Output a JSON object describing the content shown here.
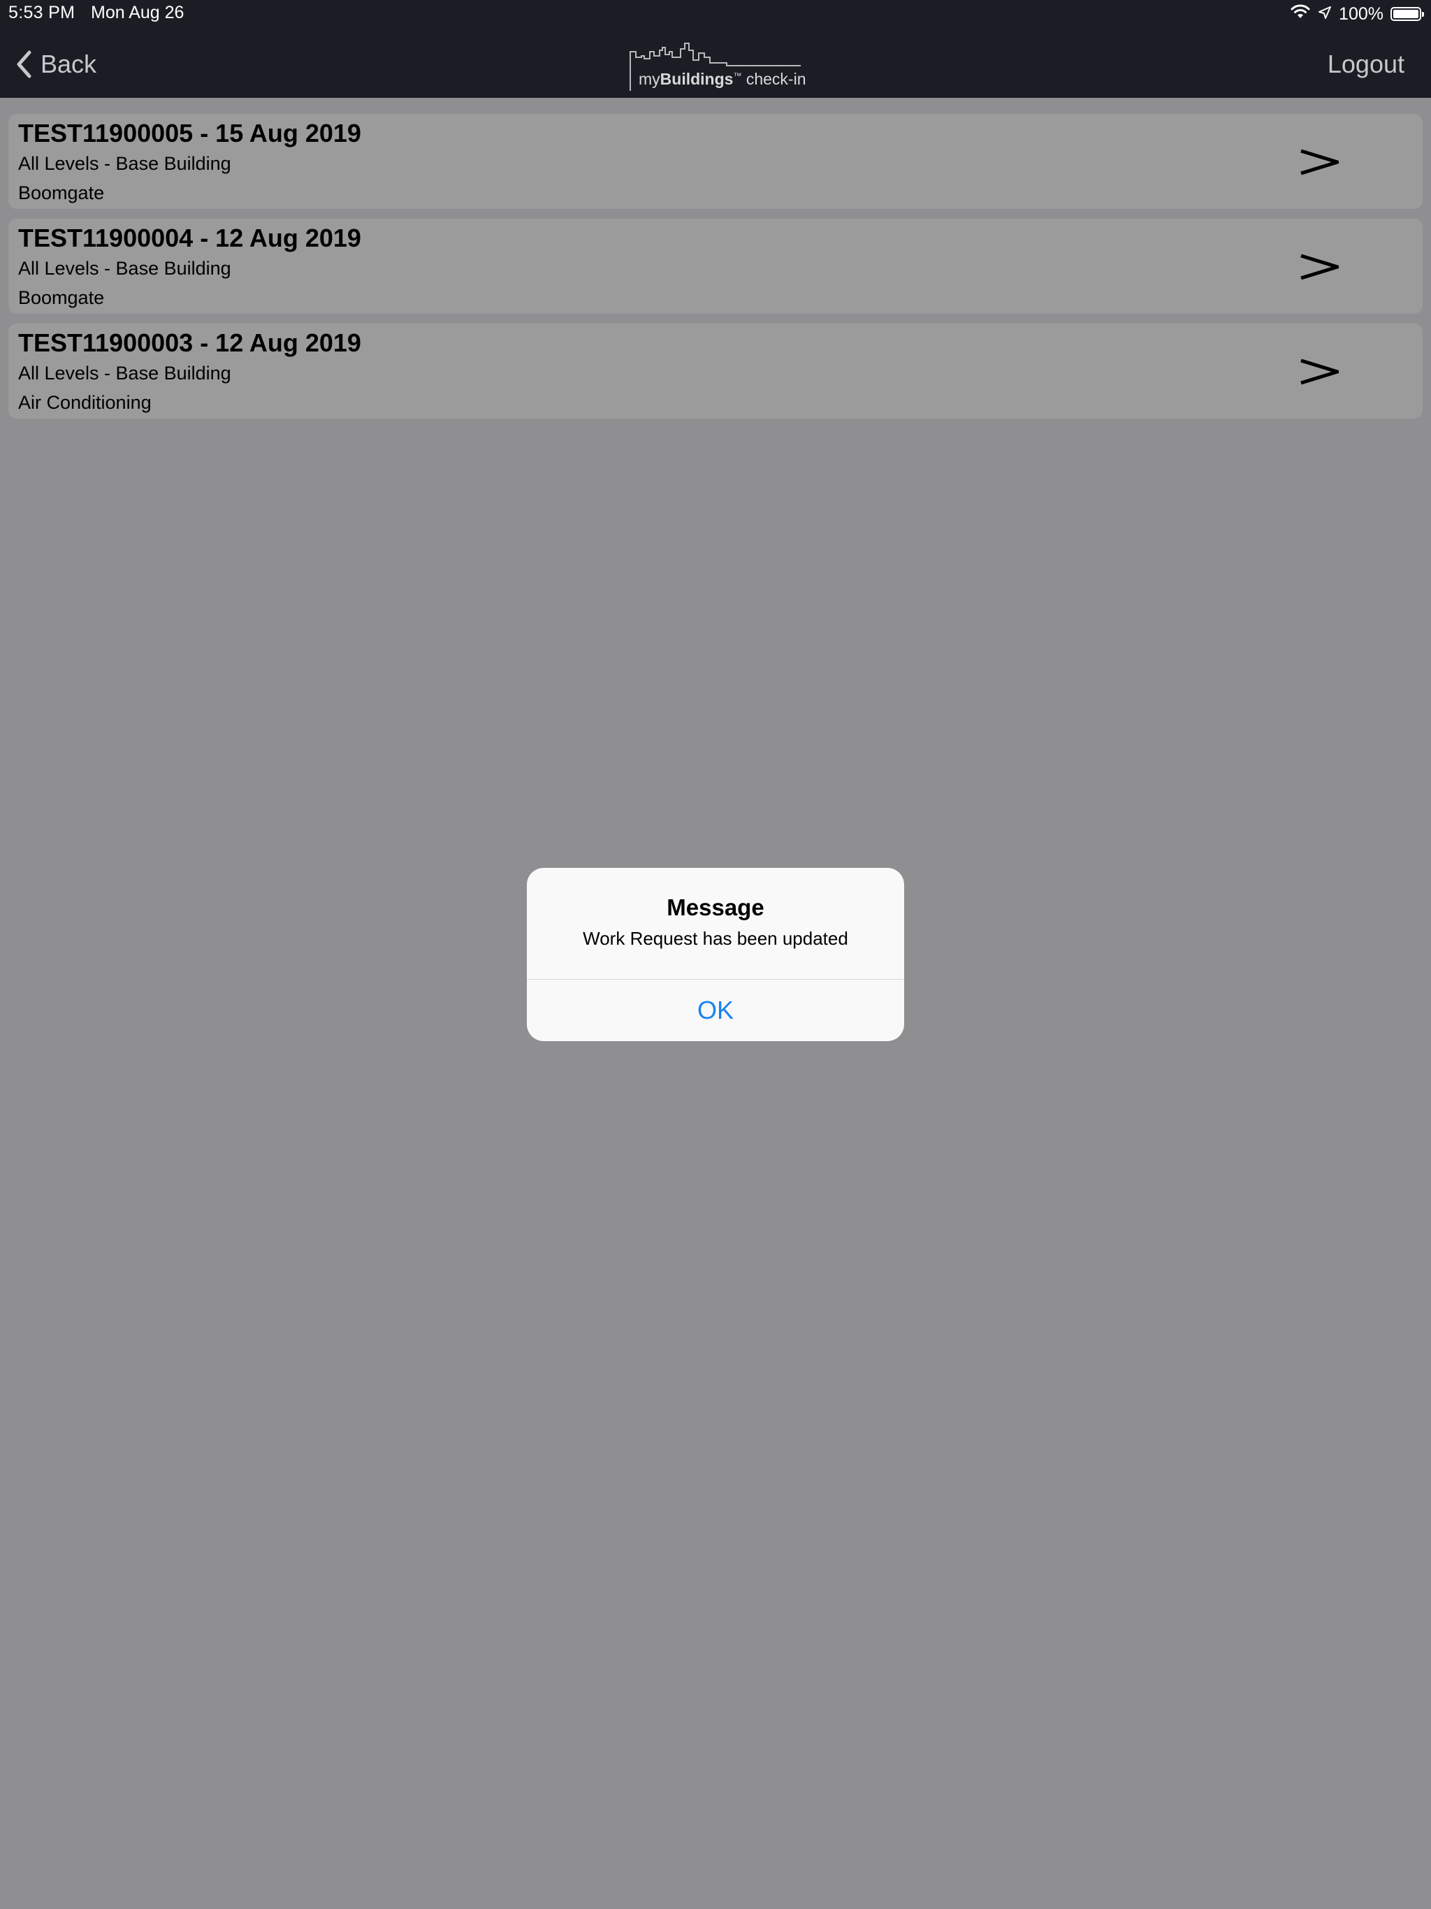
{
  "status_bar": {
    "time": "5:53 PM",
    "date": "Mon Aug 26",
    "battery": "100%",
    "icons": [
      "wifi-icon",
      "location-icon",
      "battery-icon"
    ]
  },
  "nav": {
    "back_label": "Back",
    "logo_prefix": "my",
    "logo_bold": "Buildings",
    "logo_tm": "™",
    "logo_suffix": "check-in",
    "logout_label": "Logout"
  },
  "work_requests": [
    {
      "title": "TEST11900005 - 15 Aug 2019",
      "location": "All Levels - Base Building",
      "category": "Boomgate"
    },
    {
      "title": "TEST11900004 - 12 Aug 2019",
      "location": "All Levels - Base Building",
      "category": "Boomgate"
    },
    {
      "title": "TEST11900003 - 12 Aug 2019",
      "location": "All Levels - Base Building",
      "category": "Air Conditioning"
    }
  ],
  "alert": {
    "title": "Message",
    "message": "Work Request has been updated",
    "ok_label": "OK"
  },
  "colors": {
    "header_bg": "#1a1d24",
    "dimmed_bg": "#8f8f91",
    "card_bg": "#9b9b9c",
    "alert_bg": "#f9f9f9",
    "accent_blue": "#1a82f0"
  }
}
